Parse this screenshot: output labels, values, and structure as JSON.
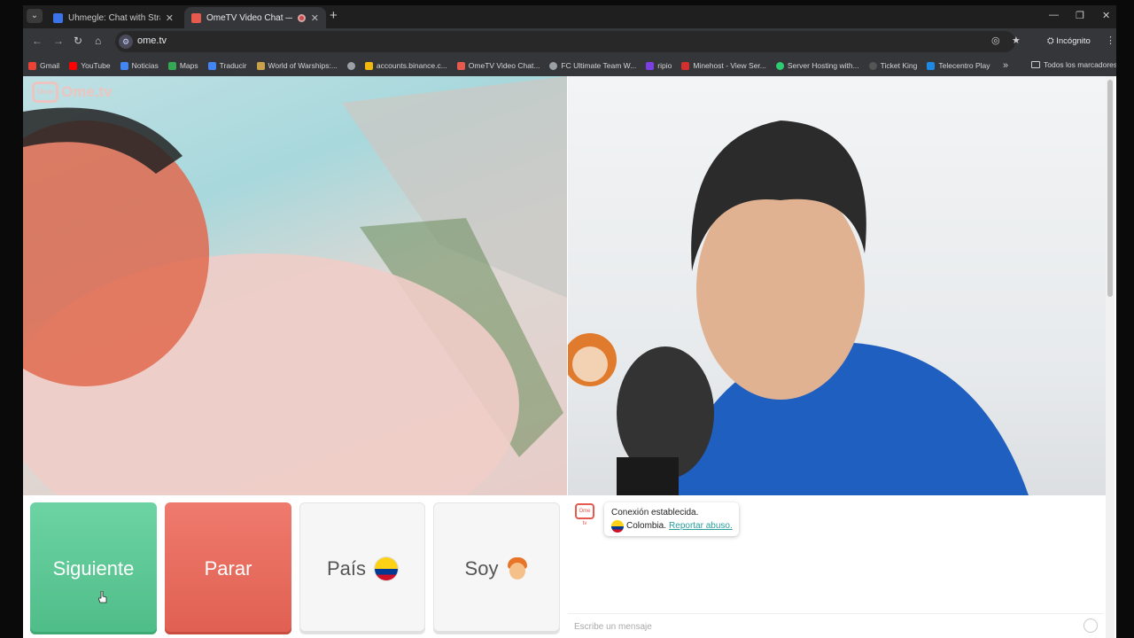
{
  "browser": {
    "tabs": [
      {
        "title": "Uhmegle: Chat with Strangers",
        "favicon_color": "#3b73e8",
        "active": false
      },
      {
        "title": "OmeTV Video Chat — Ome",
        "favicon_color": "#e55a4d",
        "active": true
      }
    ],
    "url": "ome.tv",
    "incognito_label": "Incógnito",
    "bookmarks": [
      {
        "label": "Gmail",
        "color": "#ea4335"
      },
      {
        "label": "YouTube",
        "color": "#ff0000"
      },
      {
        "label": "Noticias",
        "color": "#4285f4"
      },
      {
        "label": "Maps",
        "color": "#34a853"
      },
      {
        "label": "Traducir",
        "color": "#4285f4"
      },
      {
        "label": "World of Warships:...",
        "color": "#c9a14a"
      },
      {
        "label": "",
        "color": "#9aa0a6"
      },
      {
        "label": "accounts.binance.c...",
        "color": "#f0b90b"
      },
      {
        "label": "OmeTV Video Chat...",
        "color": "#e55a4d"
      },
      {
        "label": "FC Ultimate Team W...",
        "color": "#9aa0a6"
      },
      {
        "label": "ripio",
        "color": "#7b3fe4"
      },
      {
        "label": "Minehost - View Ser...",
        "color": "#d32f2f"
      },
      {
        "label": "Server Hosting with...",
        "color": "#2ecc71"
      },
      {
        "label": "Ticket King",
        "color": "#555555"
      },
      {
        "label": "Telecentro Play",
        "color": "#1e88e5"
      }
    ],
    "bookmarks_folder": "Todos los marcadores"
  },
  "app": {
    "logo_text": "Ome.tv",
    "logo_badge": "Ome",
    "buttons": {
      "next": "Siguiente",
      "stop": "Parar",
      "country": "País",
      "gender": "Soy"
    },
    "chat": {
      "logo_badge": "Ome tv",
      "status": "Conexión establecida.",
      "country": "Colombia.",
      "report": "Reportar abuso.",
      "placeholder": "Escribe un mensaje"
    }
  },
  "colors": {
    "next": "#5ccb97",
    "stop": "#e86b5e",
    "accent": "#2a9d9b"
  }
}
